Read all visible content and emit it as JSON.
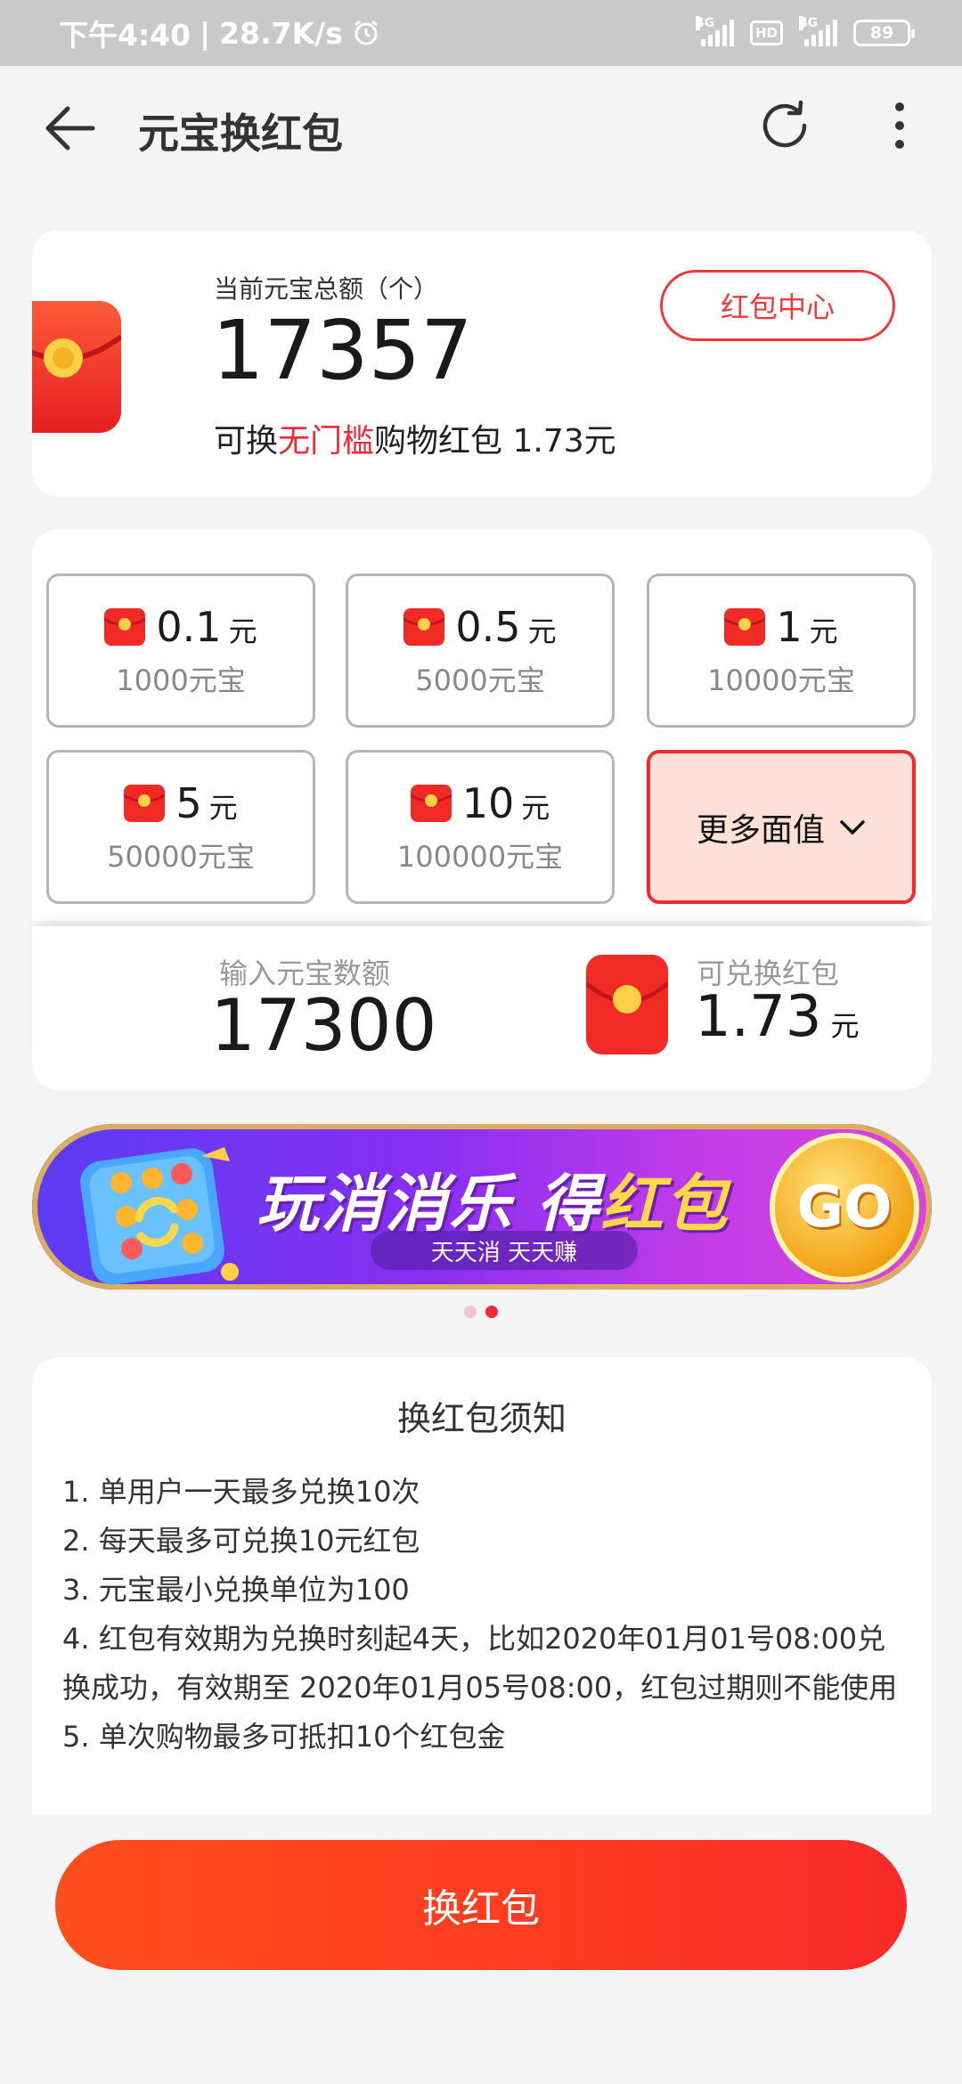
{
  "status_bar": {
    "time": "下午4:40",
    "net_speed": "28.7K/s",
    "signal1": "4G",
    "hd": "HD",
    "signal2": "4G",
    "battery": "89"
  },
  "header": {
    "title": "元宝换红包"
  },
  "balance": {
    "label": "当前元宝总额（个）",
    "value": "17357",
    "desc_prefix": "可换",
    "desc_highlight": "无门槛",
    "desc_suffix": "购物红包 1.73元",
    "center_button": "红包中心"
  },
  "options": [
    {
      "amount": "0.1",
      "unit": "元",
      "cost": "1000元宝"
    },
    {
      "amount": "0.5",
      "unit": "元",
      "cost": "5000元宝"
    },
    {
      "amount": "1",
      "unit": "元",
      "cost": "10000元宝"
    },
    {
      "amount": "5",
      "unit": "元",
      "cost": "50000元宝"
    },
    {
      "amount": "10",
      "unit": "元",
      "cost": "100000元宝"
    }
  ],
  "more_option": {
    "label": "更多面值"
  },
  "input": {
    "label": "输入元宝数额",
    "value": "17300",
    "exchange_label": "可兑换红包",
    "exchange_value": "1.73",
    "exchange_unit": "元"
  },
  "banner": {
    "title_white": "玩消消乐 得",
    "title_gold": "红包",
    "subtitle": "天天消 天天赚",
    "go": "GO"
  },
  "rules": {
    "title": "换红包须知",
    "items": [
      "1. 单用户一天最多兑换10次",
      "2. 每天最多可兑换10元红包",
      "3. 元宝最小兑换单位为100",
      "4. 红包有效期为兑换时刻起4天，比如2020年01月01号08:00兑换成功，有效期至 2020年01月05号08:00，红包过期则不能使用",
      "5. 单次购物最多可抵扣10个红包金"
    ]
  },
  "action": {
    "exchange_button": "换红包"
  },
  "colors": {
    "accent": "#f5283a",
    "button": "#ff3a21"
  }
}
